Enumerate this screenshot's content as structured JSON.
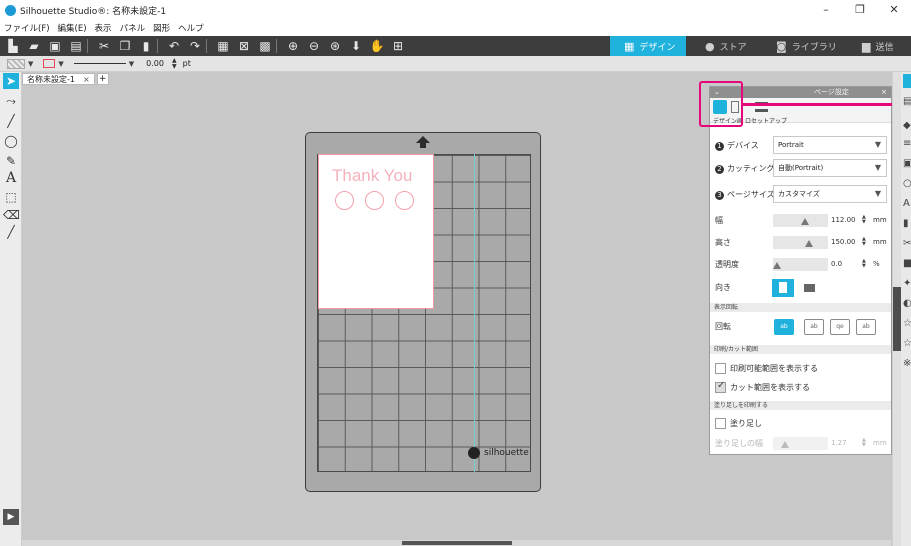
{
  "window": {
    "title": "Silhouette Studio®: 名称未設定-1",
    "minimize": "–",
    "maximize": "❐",
    "close": "✕"
  },
  "menu": [
    "ファイル(F)",
    "編集(E)",
    "表示",
    "パネル",
    "図形",
    "ヘルプ"
  ],
  "toolbar": {
    "icons": [
      "new-icon",
      "open-icon",
      "save-icon",
      "print-icon",
      "cut-icon",
      "copy-icon",
      "paste-icon",
      "undo-icon",
      "redo-icon",
      "select-all-icon",
      "deselect-icon",
      "select-icon",
      "zoom-in-icon",
      "zoom-out-icon",
      "zoom-fit-icon",
      "move-down-icon",
      "pan-icon",
      "add-page-icon"
    ],
    "nav": [
      {
        "label": "デザイン",
        "icon": "grid-icon",
        "active": true
      },
      {
        "label": "ストア",
        "icon": "silhouette-icon",
        "active": false
      },
      {
        "label": "ライブラリ",
        "icon": "library-icon",
        "active": false
      },
      {
        "label": "送信",
        "icon": "send-icon",
        "active": false
      }
    ]
  },
  "options": {
    "line_width": "0.00",
    "unit": "pt"
  },
  "doc_tab": {
    "label": "名称未設定-1",
    "close": "×",
    "add": "+"
  },
  "canvas": {
    "card_text": "Thank You",
    "mat_brand": "silhouette"
  },
  "page_panel": {
    "title": "ページ設定",
    "tabs": [
      {
        "label": "デザイン画"
      },
      {
        "label": "ロセットアップ"
      }
    ],
    "device_label": "デバイス",
    "device_value": "Portrait",
    "cutting_mat_label": "カッティング用 台紙",
    "cutting_mat_value": "自動(Portrait)",
    "page_size_label": "ページサイズ",
    "page_size_value": "カスタマイズ",
    "width_label": "幅",
    "width_value": "112.00",
    "width_unit": "mm",
    "height_label": "高さ",
    "height_value": "150.00",
    "height_unit": "mm",
    "transparency_label": "透明度",
    "transparency_value": "0.0",
    "transparency_unit": "%",
    "orientation_label": "向き",
    "display_rotation_section": "表示回転",
    "rotation_label": "回転",
    "rotation_options": [
      "ab",
      "ab",
      "qe",
      "ab"
    ],
    "print_cut_section": "印刷/カット範囲",
    "show_print_area": "印刷可能範囲を表示する",
    "show_print_area_checked": false,
    "show_cut_area": "カット範囲を表示する",
    "show_cut_area_checked": true,
    "bleed_section": "塗り足しを印刷する",
    "bleed_label": "塗り足し",
    "bleed_checked": false,
    "bleed_width_label": "塗り足しの幅",
    "bleed_width_value": "1.27",
    "bleed_width_unit": "mm"
  },
  "colors": {
    "accent": "#1eb2dc",
    "highlight": "#e4087a",
    "toolbar": "#3d3d3d",
    "card_pink": "#f4b2bb"
  }
}
